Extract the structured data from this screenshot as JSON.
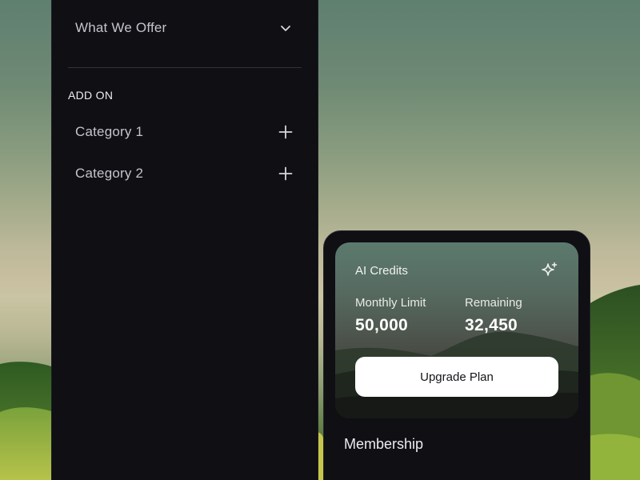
{
  "sidebar": {
    "what_we_offer": {
      "label": "What We Offer",
      "icon": "chevron-down-icon"
    },
    "add_on_heading": "ADD ON",
    "categories": [
      {
        "label": "Category 1",
        "icon": "plus-icon"
      },
      {
        "label": "Category 2",
        "icon": "plus-icon"
      }
    ]
  },
  "credits_card": {
    "title": "AI Credits",
    "icon": "sparkle-icon",
    "monthly_limit_label": "Monthly Limit",
    "monthly_limit_value": "50,000",
    "remaining_label": "Remaining",
    "remaining_value": "32,450",
    "upgrade_label": "Upgrade Plan"
  },
  "membership": {
    "title": "Membership"
  },
  "colors": {
    "panel_bg": "#0f0f14",
    "button_bg": "#ffffff",
    "text_primary": "#ececf2",
    "text_muted": "#c4c4cc"
  }
}
